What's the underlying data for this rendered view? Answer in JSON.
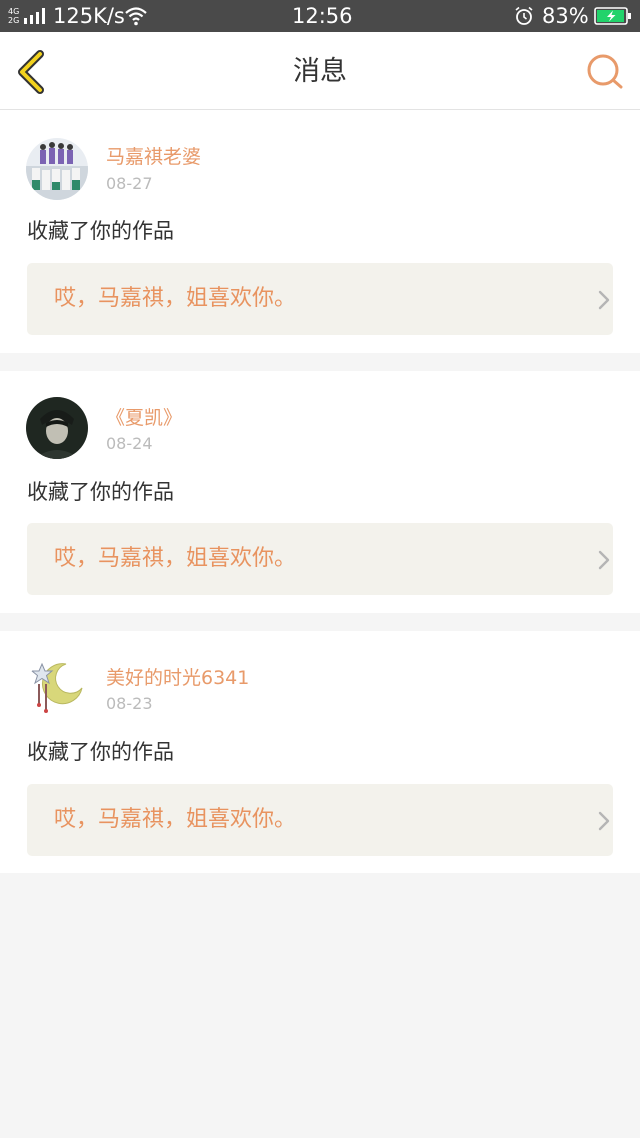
{
  "status_bar": {
    "network_top": "4G",
    "network_bottom": "2G",
    "speed": "125K/s",
    "time": "12:56",
    "battery": "83%",
    "battery_color": "#22d36b"
  },
  "header": {
    "title": "消息",
    "back_icon": "chevron-left-icon",
    "search_icon": "search-icon",
    "accent_color": "#e89a6a",
    "back_color": "#f2d21e"
  },
  "messages": [
    {
      "user": "马嘉祺老婆",
      "date": "08-27",
      "action": "收藏了你的作品",
      "quote": "哎，马嘉祺，姐喜欢你。",
      "avatar": "group-photo-avatar"
    },
    {
      "user": "《夏凯》",
      "date": "08-24",
      "action": "收藏了你的作品",
      "quote": "哎，马嘉祺，姐喜欢你。",
      "avatar": "portrait-avatar"
    },
    {
      "user": "美好的时光6341",
      "date": "08-23",
      "action": "收藏了你的作品",
      "quote": "哎，马嘉祺，姐喜欢你。",
      "avatar": "moon-star-avatar"
    }
  ]
}
